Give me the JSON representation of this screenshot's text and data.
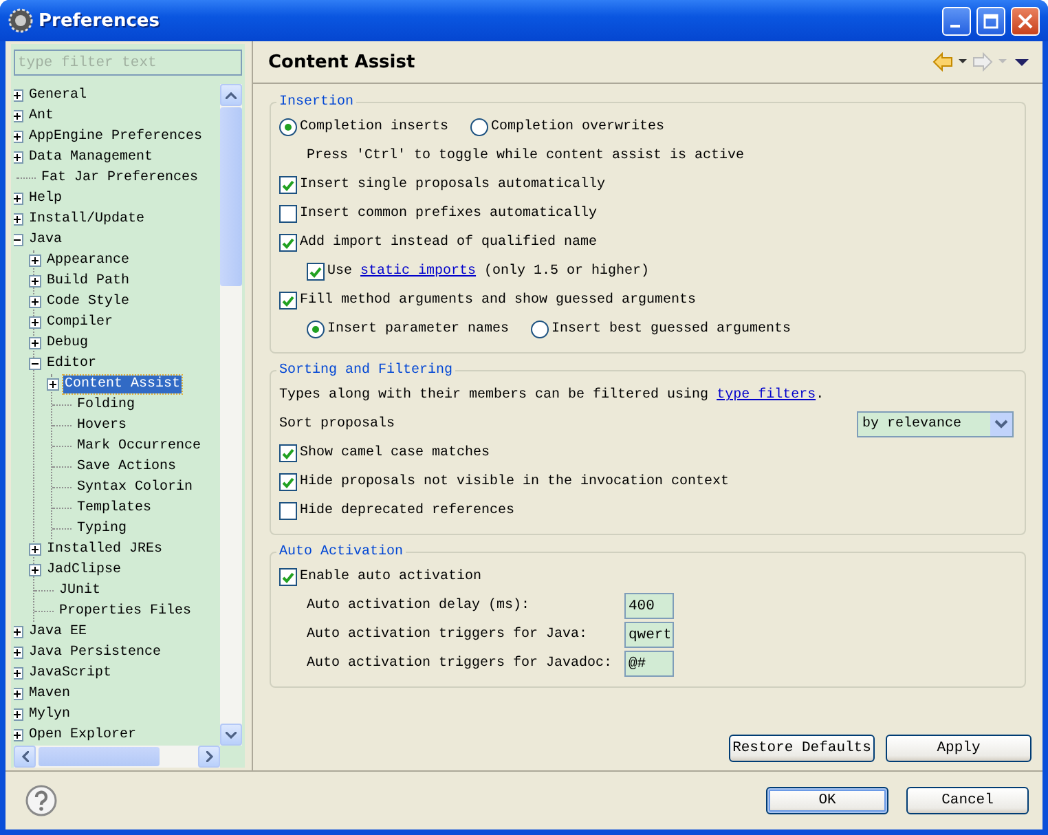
{
  "window": {
    "title": "Preferences"
  },
  "filter": {
    "placeholder": "type filter text"
  },
  "tree": [
    {
      "label": "General",
      "expanded": false
    },
    {
      "label": "Ant",
      "expanded": false
    },
    {
      "label": "AppEngine Preferences",
      "expanded": false
    },
    {
      "label": "Data Management",
      "expanded": false
    },
    {
      "label": "Fat Jar Preferences"
    },
    {
      "label": "Help",
      "expanded": false
    },
    {
      "label": "Install/Update",
      "expanded": false
    },
    {
      "label": "Java",
      "expanded": true,
      "children": [
        {
          "label": "Appearance",
          "expanded": false
        },
        {
          "label": "Build Path",
          "expanded": false
        },
        {
          "label": "Code Style",
          "expanded": false
        },
        {
          "label": "Compiler",
          "expanded": false
        },
        {
          "label": "Debug",
          "expanded": false
        },
        {
          "label": "Editor",
          "expanded": true,
          "children": [
            {
              "label": "Content Assist",
              "expanded": false,
              "selected": true
            },
            {
              "label": "Folding",
              "selected": false
            },
            {
              "label": "Hovers",
              "selected": false
            },
            {
              "label": "Mark Occurrence",
              "selected": false
            },
            {
              "label": "Save Actions",
              "selected": false
            },
            {
              "label": "Syntax Colorin",
              "selected": false
            },
            {
              "label": "Templates",
              "selected": false
            },
            {
              "label": "Typing",
              "selected": false
            }
          ]
        },
        {
          "label": "Installed JREs",
          "expanded": false
        },
        {
          "label": "JadClipse",
          "expanded": false
        },
        {
          "label": "JUnit"
        },
        {
          "label": "Properties Files"
        }
      ]
    },
    {
      "label": "Java EE",
      "expanded": false
    },
    {
      "label": "Java Persistence",
      "expanded": false
    },
    {
      "label": "JavaScript",
      "expanded": false
    },
    {
      "label": "Maven",
      "expanded": false
    },
    {
      "label": "Mylyn",
      "expanded": false
    },
    {
      "label": "Open Explorer",
      "expanded": false
    }
  ],
  "page": {
    "title": "Content Assist"
  },
  "sections": [
    {
      "title": "Insertion",
      "rows": [
        {
          "kind": "radios",
          "options": [
            {
              "label": "Completion inserts",
              "selected": true
            },
            {
              "label": "Completion overwrites",
              "selected": false
            }
          ],
          "children": [
            {
              "kind": "note",
              "text": "Press 'Ctrl' to toggle while content assist is active"
            }
          ]
        },
        {
          "kind": "checkbox",
          "label": "Insert single proposals automatically",
          "checked": true
        },
        {
          "kind": "checkbox",
          "label": "Insert common prefixes automatically",
          "checked": false
        },
        {
          "kind": "checkbox",
          "label": "Add import instead of qualified name",
          "checked": true,
          "children": [
            {
              "kind": "checkbox",
              "label": "Use ",
              "link": "static imports",
              "suffix": " (only 1.5 or higher)",
              "checked": true
            }
          ]
        },
        {
          "kind": "checkbox",
          "label": "Fill method arguments and show guessed arguments",
          "checked": true,
          "children": [
            {
              "kind": "radios",
              "options": [
                {
                  "label": "Insert parameter names",
                  "selected": true
                },
                {
                  "label": "Insert best guessed arguments",
                  "selected": false
                }
              ]
            }
          ]
        }
      ]
    },
    {
      "title": "Sorting and Filtering",
      "rows": [
        {
          "kind": "note",
          "text": "Types along with their members can be filtered using ",
          "link": "type filters",
          "suffix": "."
        },
        {
          "kind": "select",
          "label": "Sort proposals",
          "value": "by relevance"
        },
        {
          "kind": "checkbox",
          "label": "Show camel case matches",
          "checked": true
        },
        {
          "kind": "checkbox",
          "label": "Hide proposals not visible in the invocation context",
          "checked": true
        },
        {
          "kind": "checkbox",
          "label": "Hide deprecated references",
          "checked": false
        }
      ]
    },
    {
      "title": "Auto Activation",
      "rows": [
        {
          "kind": "checkbox",
          "label": "Enable auto activation",
          "checked": true,
          "children": [
            {
              "kind": "field",
              "label": "Auto activation delay (ms):",
              "value": "400"
            },
            {
              "kind": "field",
              "label": "Auto activation triggers for Java:",
              "value": "qwert"
            },
            {
              "kind": "field",
              "label": "Auto activation triggers for Javadoc:",
              "value": "@#"
            }
          ]
        }
      ]
    }
  ],
  "page_buttons": [
    "Restore Defaults",
    "Apply"
  ],
  "dialog_buttons": [
    {
      "label": "OK",
      "default": true
    },
    {
      "label": "Cancel",
      "default": false
    }
  ]
}
